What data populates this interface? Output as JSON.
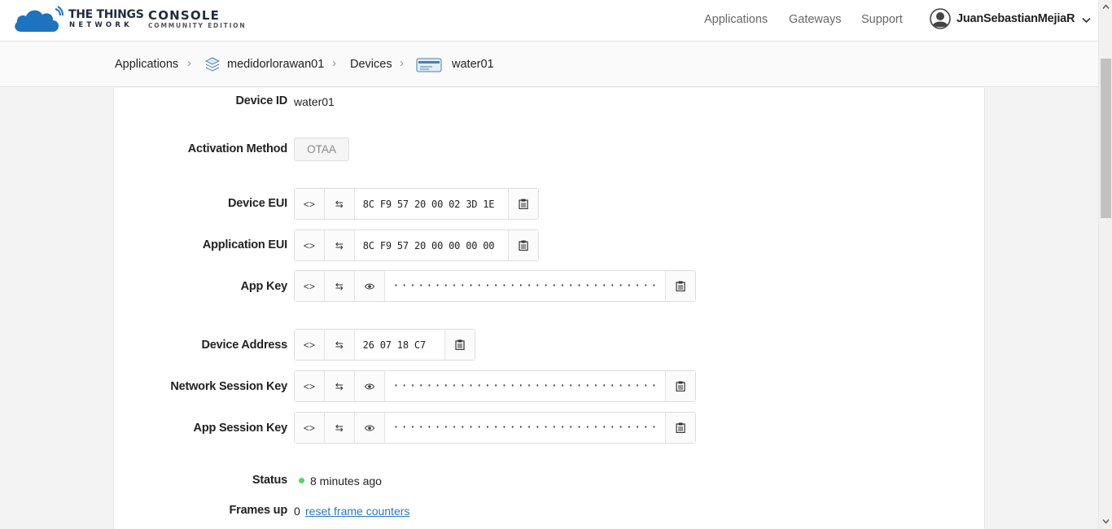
{
  "header": {
    "brand_line1": "THE THINGS",
    "brand_line2": "NETWORK",
    "console_line1": "CONSOLE",
    "console_line2": "COMMUNITY EDITION",
    "nav": [
      "Applications",
      "Gateways",
      "Support"
    ],
    "user_name": "JuanSebastianMejiaR"
  },
  "breadcrumb": {
    "items": [
      "Applications",
      "medidorlorawan01",
      "Devices",
      "water01"
    ]
  },
  "device": {
    "device_id_label": "Device ID",
    "device_id": "water01",
    "activation_label": "Activation Method",
    "activation": "OTAA",
    "device_eui_label": "Device EUI",
    "device_eui": "8C F9 57 20 00 02 3D 1E",
    "app_eui_label": "Application EUI",
    "app_eui": "8C F9 57 20 00 00 00 00",
    "app_key_label": "App Key",
    "app_key": "································",
    "dev_addr_label": "Device Address",
    "dev_addr": "26 07 18 C7",
    "nwk_skey_label": "Network Session Key",
    "nwk_skey": "································",
    "app_skey_label": "App Session Key",
    "app_skey": "································",
    "status_label": "Status",
    "status": "8 minutes ago",
    "frames_up_label": "Frames up",
    "frames_up": "0",
    "reset_link": "reset frame counters"
  },
  "icons": {
    "code": "<>",
    "swap": "⇆"
  },
  "colors": {
    "link": "#2a7ab8",
    "status_ok": "#5bd46b",
    "logo_blue": "#1e73be"
  }
}
